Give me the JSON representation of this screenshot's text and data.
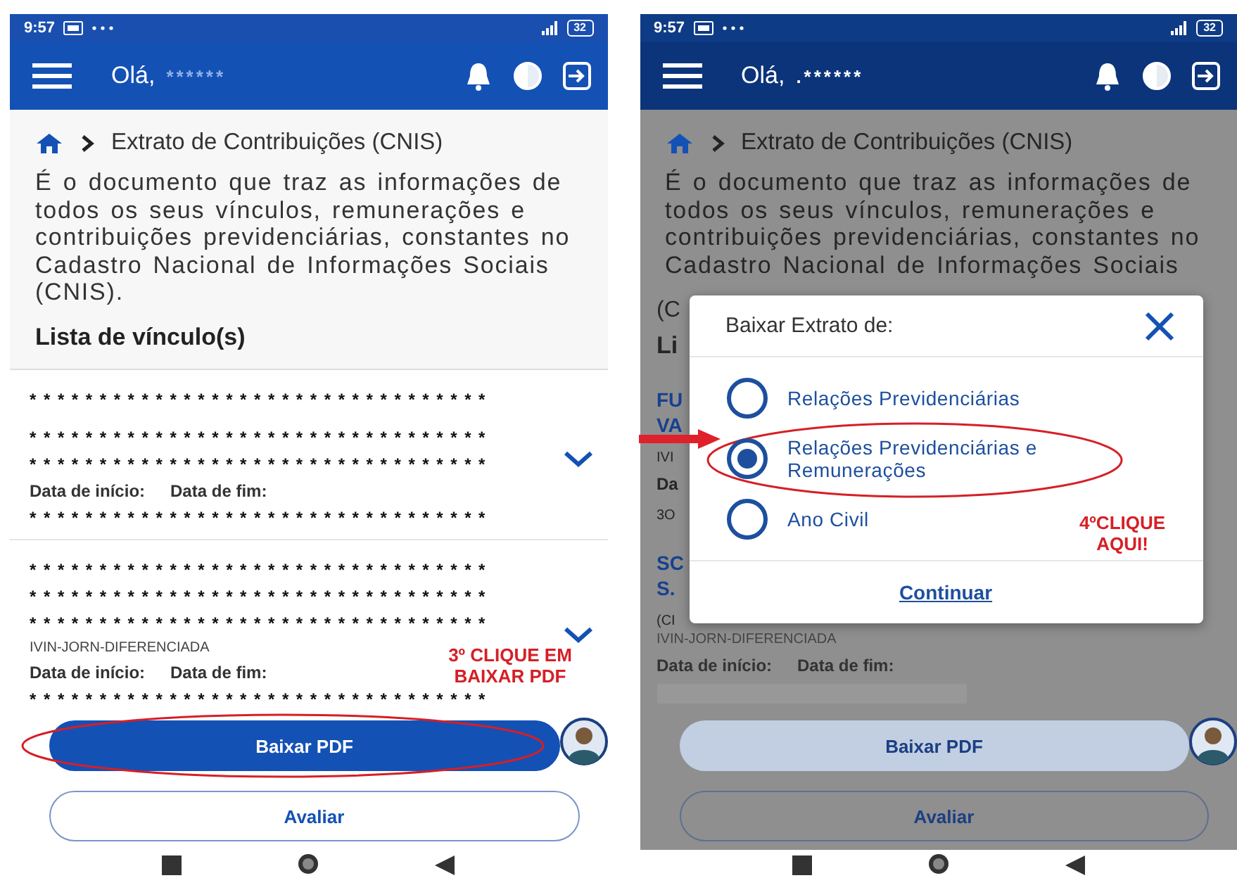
{
  "screens": [
    {
      "dimmed": false,
      "status_bar": {
        "time": "9:57",
        "battery": "32"
      },
      "header": {
        "greeting": "Olá,",
        "user": "******"
      },
      "breadcrumb": {
        "title": "Extrato de Contribuições (CNIS)"
      },
      "description": "É o documento que traz as informações de todos os seus vínculos, remunerações e contribuições previdenciárias, constantes no Cadastro Nacional de Informações Sociais (CNIS).",
      "section_title": "Lista de vínculo(s)",
      "vinculos": [
        {
          "lines": [
            "*********************************",
            "*********************************",
            "*********************************"
          ],
          "start_label": "Data de início:",
          "end_label": "Data de fim:",
          "dates": "*********************************"
        },
        {
          "lines": [
            "*********************************",
            "*********************************",
            "*********************************"
          ],
          "subtitle": "IVIN-JORN-DIFERENCIADA",
          "start_label": "Data de início:",
          "end_label": "Data de fim:",
          "dates": "*********************************"
        }
      ],
      "buttons": [
        {
          "label": "Baixar PDF",
          "kind": "primary"
        },
        {
          "label": "Avaliar",
          "kind": "outline"
        }
      ],
      "annotation": "3º CLIQUE EM BAIXAR PDF"
    },
    {
      "dimmed": true,
      "status_bar": {
        "time": "9:57",
        "battery": "32"
      },
      "header": {
        "greeting": "Olá,",
        "user": ".******"
      },
      "breadcrumb": {
        "title": "Extrato de Contribuições (CNIS)"
      },
      "description": "É o documento que traz as informações de todos os seus vínculos, remunerações e contribuições previdenciárias, constantes no Cadastro Nacional de Informações Sociais",
      "behind_dialog": [
        {
          "kind": "paragraph",
          "text": "(C"
        },
        {
          "kind": "section",
          "text": "Li"
        },
        {
          "kind": "title",
          "text": "FU"
        },
        {
          "kind": "title",
          "text": "VA"
        },
        {
          "kind": "small",
          "text": "IVI"
        },
        {
          "kind": "label",
          "text": "Da"
        },
        {
          "kind": "small",
          "text": "3O"
        },
        {
          "kind": "title",
          "text": "SC"
        },
        {
          "kind": "title",
          "text": "S."
        },
        {
          "kind": "small",
          "text": "(CI"
        }
      ],
      "vinculos": [
        {
          "subtitle": "IVIN-JORN-DIFERENCIADA",
          "start_label": "Data de início:",
          "end_label": "Data de fim:"
        }
      ],
      "buttons": [
        {
          "label": "Baixar PDF",
          "kind": "primary"
        },
        {
          "label": "Avaliar",
          "kind": "outline"
        }
      ],
      "dialog": {
        "title": "Baixar Extrato de:",
        "options": [
          {
            "label": "Relações Previdenciárias",
            "selected": false
          },
          {
            "label": "Relações Previdenciárias e Remunerações",
            "selected": true
          },
          {
            "label": "Ano Civil",
            "selected": false
          }
        ],
        "link": "Continuar",
        "annotation": "4ºCLIQUE AQUI!"
      }
    }
  ]
}
